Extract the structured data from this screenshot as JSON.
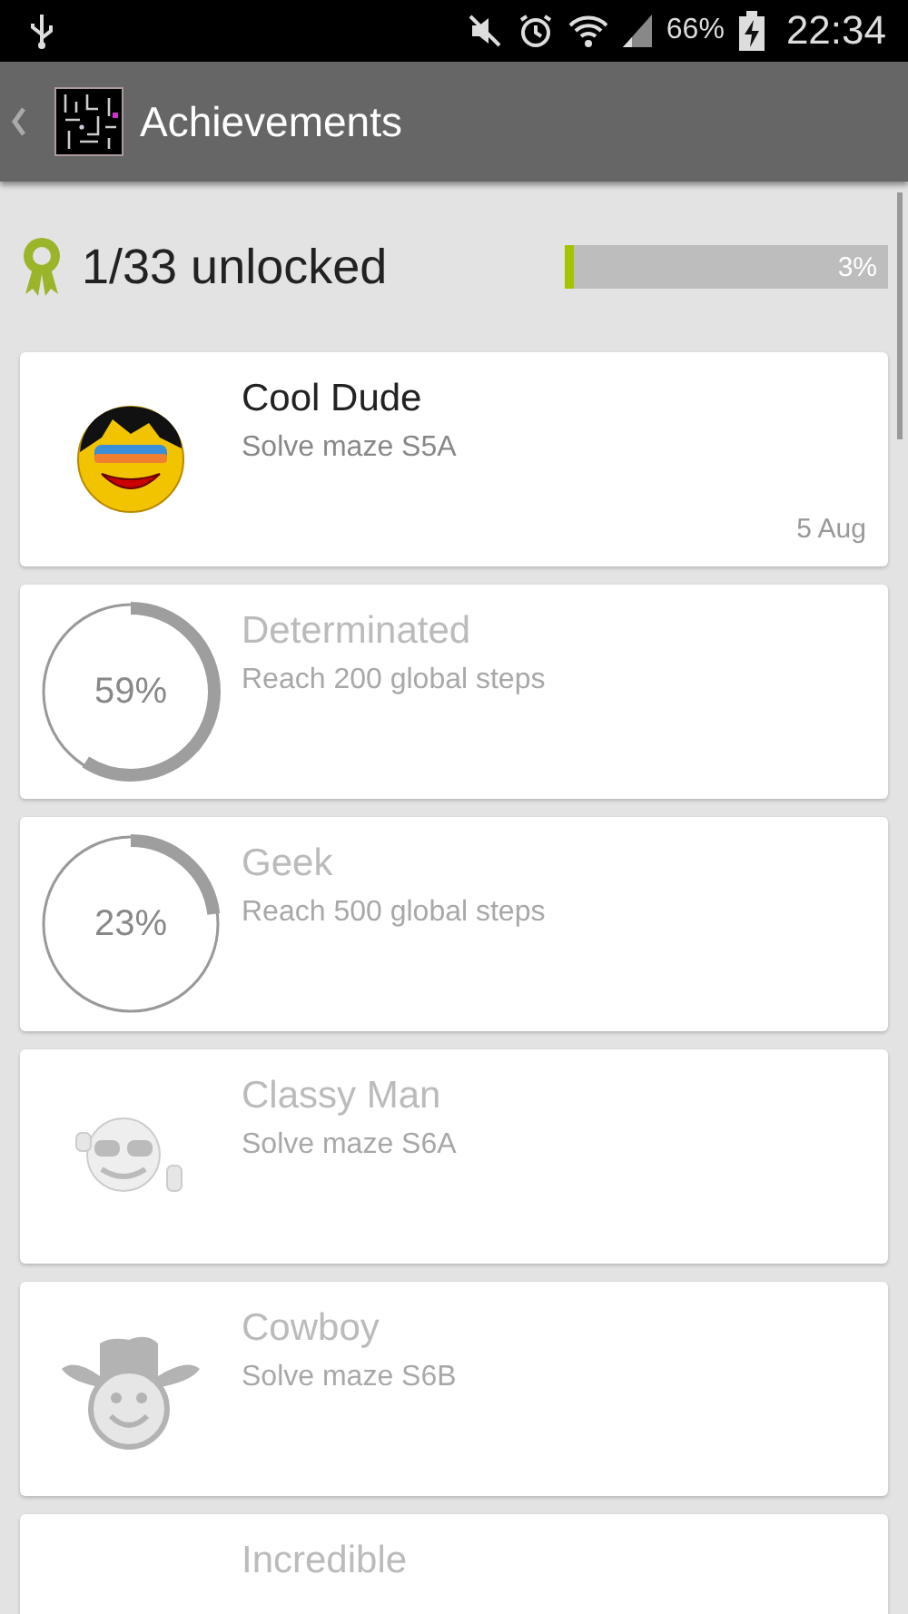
{
  "status_bar": {
    "battery": "66%",
    "time": "22:34"
  },
  "app_bar": {
    "title": "Achievements"
  },
  "summary": {
    "text": "1/33 unlocked",
    "level": 0.03,
    "reading": "3%"
  },
  "achievements": [
    {
      "kind": "smiley",
      "title": "Cool Dude",
      "description": "Solve maze S5A",
      "unlocked": true,
      "date": "5 Aug"
    },
    {
      "kind": "progress",
      "title": "Determinated",
      "description": "Reach 200 global steps",
      "unlocked": false,
      "reading": "59%"
    },
    {
      "kind": "progress",
      "title": "Geek",
      "description": "Reach 500 global steps",
      "unlocked": false,
      "reading": "23%"
    },
    {
      "kind": "sunglasses",
      "title": "Classy Man",
      "description": "Solve maze S6A",
      "unlocked": false
    },
    {
      "kind": "cowboy",
      "title": "Cowboy",
      "description": "Solve maze S6B",
      "unlocked": false
    },
    {
      "kind": "blank",
      "title": "Incredible",
      "unlocked": false
    }
  ]
}
